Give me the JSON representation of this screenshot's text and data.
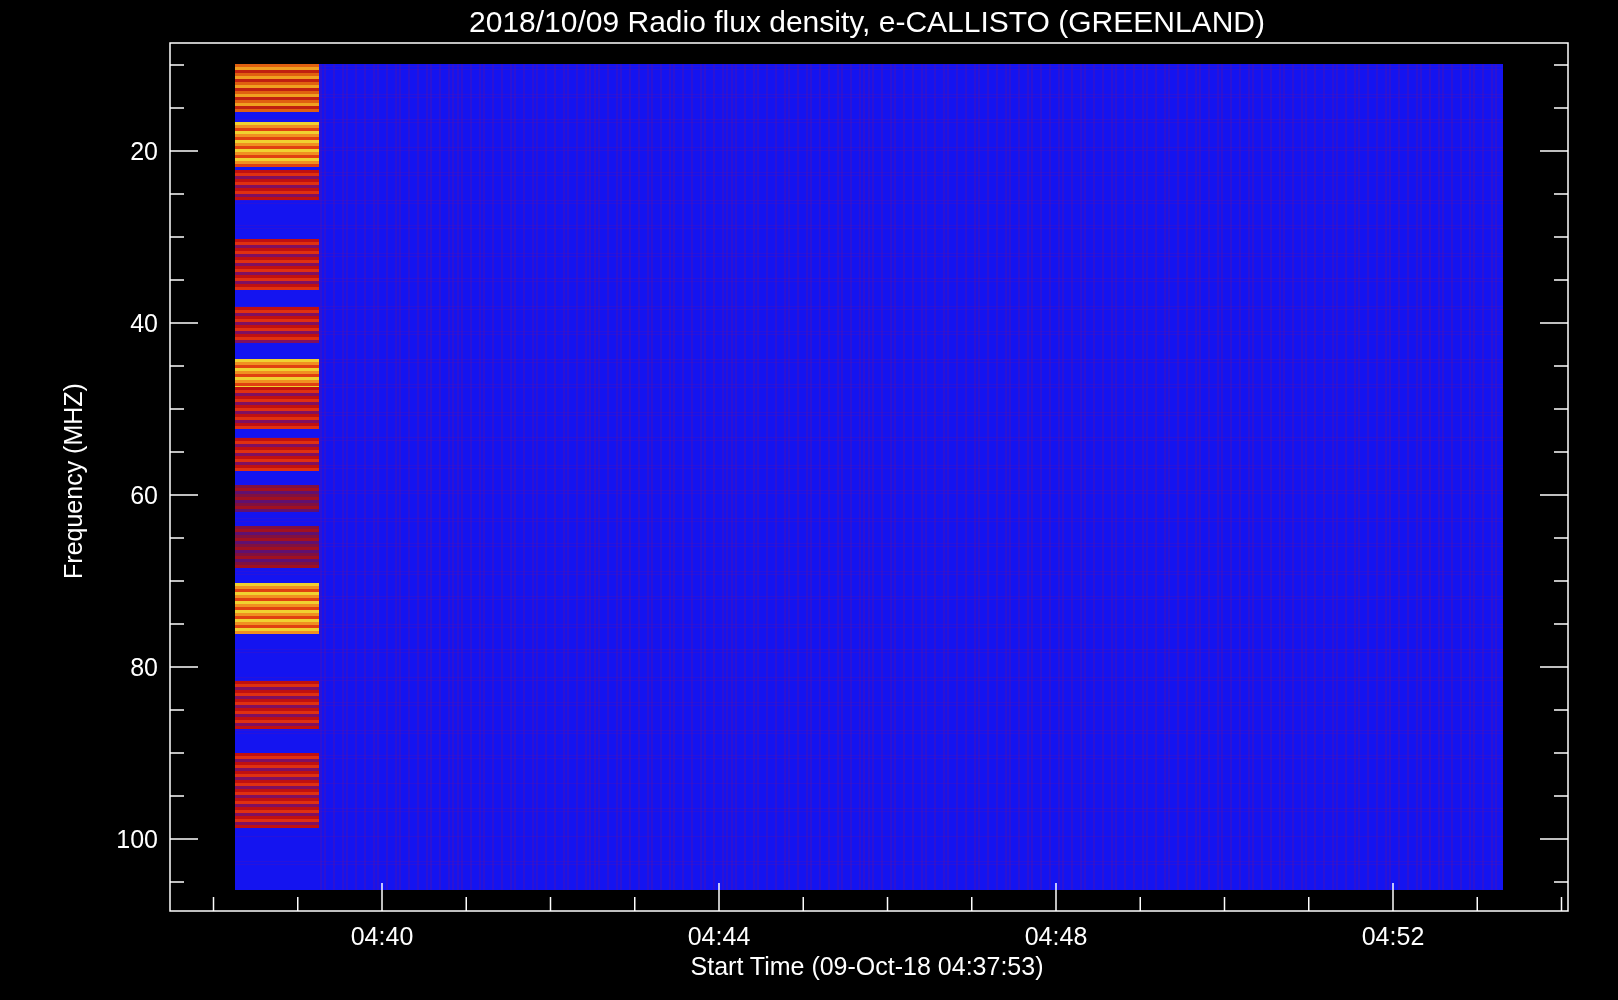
{
  "title": "2018/10/09  Radio flux density, e-CALLISTO (GREENLAND)",
  "y_axis": {
    "label": "Frequency (MHZ)",
    "ticks": [
      "20",
      "40",
      "60",
      "80",
      "100"
    ]
  },
  "x_axis": {
    "label": "Start Time (09-Oct-18 04:37:53)",
    "ticks": [
      "04:40",
      "04:44",
      "04:48",
      "04:52"
    ]
  }
}
